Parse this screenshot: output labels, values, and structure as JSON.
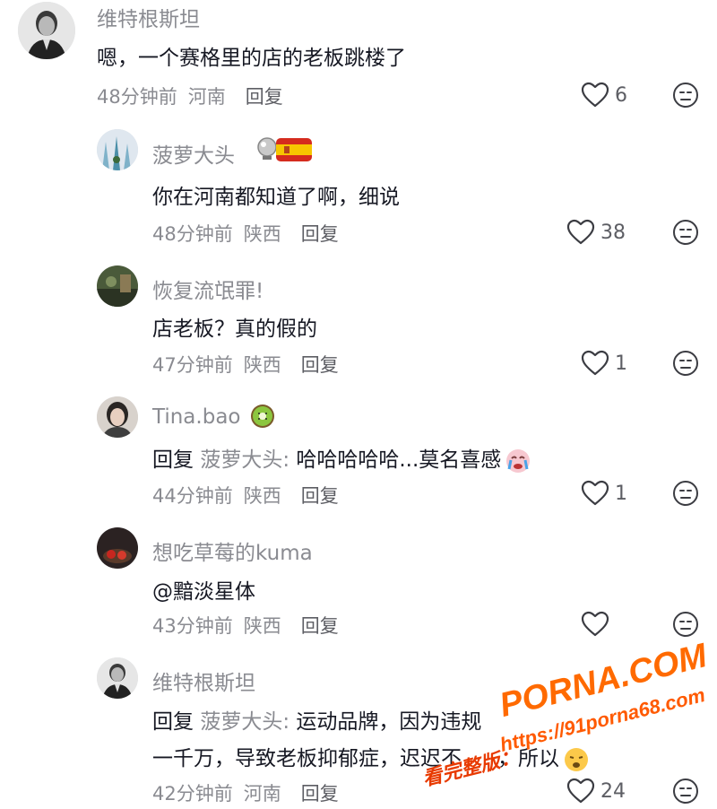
{
  "comments": [
    {
      "username": "维特根斯坦",
      "text": "嗯，一个赛格里的店的老板跳楼了",
      "time": "48分钟前",
      "location": "河南",
      "reply_label": "回复",
      "likes": "6",
      "avatar_icon": "portrait-man-suit"
    },
    {
      "username": "菠萝大头",
      "text": "你在河南都知道了啊，细说",
      "time": "48分钟前",
      "location": "陕西",
      "reply_label": "回复",
      "likes": "38",
      "badges": [
        "silver-ball-icon",
        "spain-flag-icon"
      ],
      "avatar_icon": "wintry-scene"
    },
    {
      "username": "恢复流氓罪!",
      "text": "店老板？真的假的",
      "time": "47分钟前",
      "location": "陕西",
      "reply_label": "回复",
      "likes": "1",
      "avatar_icon": "dark-photo"
    },
    {
      "username": "Tina.bao",
      "reply_prefix": "回复",
      "reply_to": "菠萝大头:",
      "text": "哈哈哈哈哈...莫名喜感",
      "time": "44分钟前",
      "location": "陕西",
      "reply_label": "回复",
      "likes": "1",
      "badges": [
        "kiwi-fruit-icon"
      ],
      "trailing_emoji": "crying-face-icon",
      "avatar_icon": "girl-photo"
    },
    {
      "username": "想吃草莓的kuma",
      "text": "@黯淡星体",
      "time": "43分钟前",
      "location": "陕西",
      "reply_label": "回复",
      "likes": "",
      "avatar_icon": "strawberry-photo"
    },
    {
      "username": "维特根斯坦",
      "reply_prefix": "回复",
      "reply_to": "菠萝大头:",
      "text": "运动品牌，因为违规",
      "text_line2": "一千万，导致老板抑郁症，迟迟不",
      "text_line2_end": "，所以",
      "time": "42分钟前",
      "location": "河南",
      "reply_label": "回复",
      "likes": "24",
      "trailing_emoji": "sad-face-icon",
      "avatar_icon": "portrait-man-suit"
    }
  ],
  "watermark": {
    "logo": "PORNA.COM",
    "url": "https://91porna68.com",
    "label": "看完整版："
  },
  "colors": {
    "text": "#161823",
    "meta": "#8a8b91",
    "watermark": "#ff6a00"
  }
}
